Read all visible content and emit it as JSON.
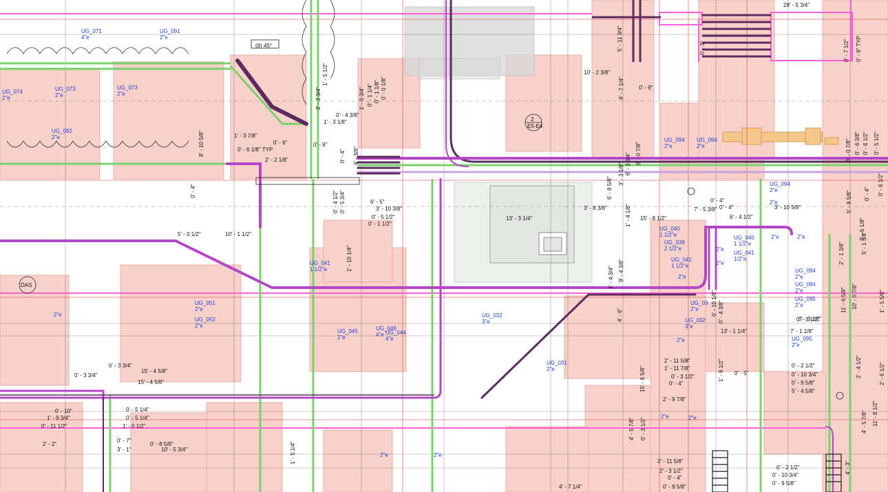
{
  "drawing": {
    "colors": {
      "background": "#ffffff",
      "zone_fill": "#f7c9c3",
      "zone_edge": "#e8a39a",
      "gray_fill": "#d9d9d9",
      "conduit_purple": "#b347c6",
      "conduit_dark": "#5b2a5e",
      "conduit_green": "#7ad36a",
      "pink_line": "#ff5fd6",
      "red_line": "#e0413a",
      "tag_blue": "#1f3fd8",
      "dim_black": "#111111",
      "orange_fill": "#f5c78d"
    },
    "circuit_tags": [
      {
        "id": "UG_071",
        "size": "4\"e"
      },
      {
        "id": "UG_091",
        "size": "2\"e"
      },
      {
        "id": "UG_074",
        "size": "2\"e"
      },
      {
        "id": "UG_073",
        "size": "2\"e"
      },
      {
        "id": "UG_073",
        "size": "2\"e"
      },
      {
        "id": "UG_092",
        "size": "2\"e"
      },
      {
        "id": "UG_094",
        "size": "2\"e"
      },
      {
        "id": "UG_094",
        "size": "2\"e"
      },
      {
        "id": "UG_094",
        "size": "2\"e"
      },
      {
        "id": "UG_040",
        "size": "1 1/2\"e"
      },
      {
        "id": "UG_039",
        "size": "2 1/2\"e"
      },
      {
        "id": "UG_041",
        "size": "1 1/2\"e"
      },
      {
        "id": "UG_040",
        "size": "1 1/2\"e"
      },
      {
        "id": "UG_041",
        "size": "1/2\"e"
      },
      {
        "id": "UG_094",
        "size": "2\"e"
      },
      {
        "id": "UG_094",
        "size": "2\"e"
      },
      {
        "id": "UG_095",
        "size": "2\"e"
      },
      {
        "id": "UG_095",
        "size": "2\"e"
      },
      {
        "id": "UG_041",
        "size": "1 1/2\"e"
      },
      {
        "id": "UG_051",
        "size": "2\"e"
      },
      {
        "id": "UG_052",
        "size": "2\"e"
      },
      {
        "id": "UG_045",
        "size": "2\"e"
      },
      {
        "id": "UG_046",
        "size": "4\"e"
      },
      {
        "id": "UG_044",
        "size": "4\"e"
      },
      {
        "id": "UG_032",
        "size": "3\"e"
      },
      {
        "id": "UG_031",
        "size": "2\"e"
      },
      {
        "id": "UG_03",
        "size": "2\"e"
      },
      {
        "id": "UG_032",
        "size": "3\"e"
      }
    ],
    "size_labels": [
      "2\"e",
      "2\"e",
      "2\"e",
      "2\"e",
      "2\"e",
      "2\"e",
      "2\"e",
      "2\"e",
      "2\"e",
      "2\"e",
      "2\"e",
      "2\"e"
    ],
    "dimensions": [
      "28' - 5 3/4\"",
      "5' - 11 3/4\"",
      "0' - 7 1/2\"",
      "0' - 9\" TYP",
      "0' - 3\"",
      "1' - 5 1/2\"",
      "3' - 3 3/4\"",
      "1' - 0 3/4\"",
      "0' - 1 1/4\"",
      "0' - 1 1/8\"",
      "0' - 0 1/8\"",
      "0' - 4 3/8\"",
      "1' - 3 1/8\"",
      "10' - 2 3/8\"",
      "9' - 7 1/4\"",
      "0' - 9\"",
      "6' - 3 3/4\"",
      "1' - 3 7/8\"",
      "0' - 6\"",
      "0' - 6 1/8\" TYP",
      "0' - 9\"",
      "8' - 10 5/8\"",
      "2' - 2 1/8\"",
      "0' - 4\"",
      "0' - 4\"",
      "0' - 4 1/2\"",
      "0' - 5 3/4\"",
      "6' - 5\"",
      "3' - 10 3/8\"",
      "0' - 5 1/2\"",
      "0' - 1 1/2\"",
      "3' - 8 3/8\"",
      "13' - 3 1/4\"",
      "6' - 8 5/8\"",
      "3' - 3 1/8\"",
      "6' - 0 7/8\"",
      "1' - 4 1/8\"",
      "0' - 4\"",
      "7' - 5 3/8\"",
      "0' - 4\"",
      "3' - 10 5/8\"",
      "15' - 8 1/2\"",
      "6' - 4 1/2\"",
      "9' - 4 3/8\"",
      "1' - 4 3/4\"",
      "4' - 6\"",
      "13' - 1 1/4\"",
      "7' - 1 1/8\"",
      "0' - 3 1/2\"",
      "0' - 4 3/8\"",
      "0' - 10 1/8\"",
      "6' - 0 7/8\"",
      "0' - 6 3/8\"",
      "0' - 6 1/2\"",
      "0' - 5 1/2\"",
      "5' - 8 5/8\"",
      "0' - 6 1/2\"",
      "0' - 4\"",
      "2' - 1 3/8\"",
      "5' - 1 3/8\"",
      "3' - 5 1/8\"",
      "10' - 0 7/8\"",
      "11' - 6 5/8\"",
      "1' - 5 5/8\"",
      "0' - 2 1/2\"",
      "0' - 10 3/4\"",
      "0' - 9 5/8\"",
      "5' - 4 5/8\"",
      "2' - 4 1/2\"",
      "2' - 6 1/2\"",
      "11' - 8 1/2\"",
      "4' - 5 7/8\"",
      "2' - 11 5/8\"",
      "1' - 11 7/8\"",
      "0' - 3 1/2\"",
      "0' - 4\"",
      "2' - 9 7/8\"",
      "15' - 6 5/8\"",
      "1' - 6 1/2\"",
      "0' - 5\"",
      "4' - 5 7/8\"",
      "0' - 3 1/2\"",
      "2' - 11 5/8\"",
      "2' - 3 1/2\"",
      "0' - 4\"",
      "0' - 9 5/8\"",
      "4' - 7 1/4\"",
      "0' - 2 1/2\"",
      "0' - 10 3/4\"",
      "0' - 9 5/8\"",
      "4' - 3\"",
      "0' - 3 1/2\"",
      "0' - 5 1/4\"",
      "0' - 5 1/4\"",
      "0' - 10\"",
      "1' - 9 3/4\"",
      "0' - 11 1/2\"",
      "1' - 0 1/2\"",
      "2' - 2\"",
      "0' - 7\"",
      "0' - 8 5/8\"",
      "3' - 1\"",
      "10' - 5 3/4\"",
      "0' - 3 3/4\"",
      "0' - 3 3/4\"",
      "15' - 4 5/8\"",
      "15' - 4 5/8\"",
      "5' - 0 1/2\"",
      "10' - 1 1/2\"",
      "1' - 5 1/4\"",
      "1' - 10 1/4\"",
      "4' - 3/8\"",
      "(8) 45°"
    ],
    "symbols": {
      "grid_bubble_number": "2",
      "grid_bubble_sub": "E5-E4",
      "das_label": "DAS"
    }
  }
}
